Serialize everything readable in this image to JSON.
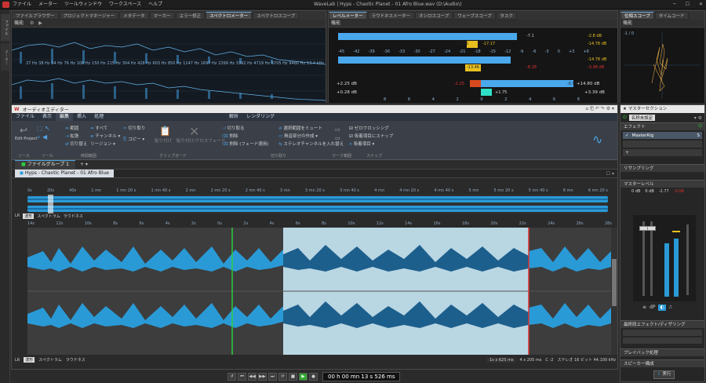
{
  "app": {
    "title": "WaveLab | Hyps - Chaotic Planet - 01 Afro Blue.wav (D:\\Audio\\)"
  },
  "menu": [
    "ファイル",
    "メーター",
    "ツールウィンドウ",
    "ワークスペース",
    "ヘルプ"
  ],
  "left_side_tabs": [
    "ファイル",
    "メーター"
  ],
  "top_left_tabs": [
    "ファイルブラウザー",
    "プロジェクトマネージャー",
    "メタデータ",
    "マーカー",
    "エラー修正",
    "スペクトロメーター",
    "スペクトロスコープ"
  ],
  "top_center_tabs": [
    "レベルメーター",
    "ラウドネスメーター",
    "オシロスコープ",
    "ウェーブスコープ",
    "タスク"
  ],
  "top_right_tabs": [
    "位相スコープ",
    "タイムコード"
  ],
  "panel_mode_label": "機能",
  "spectro": {
    "freqs": [
      "27 Hz",
      "38 Hz",
      "54 Hz",
      "76 Hz",
      "108 Hz",
      "150 Hz",
      "215 Hz",
      "304 Hz",
      "428 Hz",
      "603 Hz",
      "850 Hz",
      "1147 Hz",
      "1697 Hz",
      "2399 Hz",
      "3392 Hz",
      "4719 Hz",
      "6705 Hz",
      "9480 Hz",
      "13.4 kHz"
    ]
  },
  "levelmeter": {
    "scale": [
      "-45",
      "-42",
      "-39",
      "-36",
      "-33",
      "-30",
      "-27",
      "-24",
      "-21",
      "-18",
      "-15",
      "-12",
      "-9",
      "-6",
      "-3",
      "0",
      "+3",
      "+6"
    ],
    "ch1": {
      "rms": "-11.86",
      "peak_label": "-7.1",
      "max": "-17.17",
      "right": "-2.8 dB",
      "right2": "-14.78 dB"
    },
    "ch2": {
      "rms": "-13.46",
      "peak_label": "-8.28",
      "right": "-3.08 dB",
      "right2": "-14.78 dB"
    },
    "bal_left": "+2.25 dB",
    "bal_left2": "+0.28 dB",
    "bal_mid": "-2.25",
    "bal_mid2": "+1.75",
    "bal_r": "-0.57",
    "bal_right": "+14.80 dB",
    "bal_right2": "+3.39 dB",
    "bottom_scale": [
      "8",
      "6",
      "4",
      "2",
      "0",
      "2",
      "4",
      "6",
      "8"
    ]
  },
  "phasescope": {
    "scale": "-1 / 0"
  },
  "audio_editor": {
    "title": "オーディオエディター",
    "ribbon_tabs": [
      "ファイル",
      "表示",
      "編集",
      "挿入",
      "処理",
      "解析",
      "レンダリング"
    ],
    "groups": [
      "ソース",
      "ツール",
      "時間範囲",
      "クリップボード",
      "切り取り",
      "マーク範囲",
      "スナップ"
    ],
    "buttons": {
      "edit_project": "Edit Project",
      "range": "範囲",
      "all": "すべて",
      "extend": "拡張",
      "channel": "チャンネル",
      "toggle": "切り替え",
      "region": "リージョン",
      "cut": "切り取り",
      "copy": "コピー",
      "paste": "貼り付け",
      "paste_crossfade": "貼り付け/クロスフェード",
      "trim": "切り取る",
      "delete": "削除",
      "delete_fade": "削除 (フェード適用)",
      "mute_sel": "選択範囲をミュート",
      "create_silence": "無音部分の作成",
      "stereo_swap": "ステレオチャンネルを入れ替え",
      "zero_cross": "ゼロクロッシング",
      "snap_marks": "吸着項目にスナップ",
      "snap_items": "吸着項目"
    },
    "file_group_tab": "ファイルグループ 1",
    "file_tab": "Hyps - Chaotic Planet - 01 Afro Blue",
    "overview_ruler": [
      "0s",
      "20s",
      "40s",
      "1 mn",
      "1 mn 20 s",
      "1 mn 40 s",
      "2 mn",
      "2 mn 20 s",
      "2 mn 40 s",
      "3 mn",
      "3 mn 20 s",
      "3 mn 40 s",
      "4 mn",
      "4 mn 20 s",
      "4 mn 40 s",
      "5 mn",
      "5 mn 20 s",
      "5 mn 40 s",
      "6 mn",
      "6 mn 20 s"
    ],
    "main_ruler": [
      "14s",
      "12s",
      "10s",
      "8s",
      "6s",
      "4s",
      "2s",
      "0s",
      "2s",
      "4s",
      "6s",
      "8s",
      "10s",
      "12s",
      "14s",
      "16s",
      "18s",
      "20s",
      "22s",
      "24s",
      "26s",
      "28s"
    ],
    "view_tabs": [
      "波形",
      "スペクトラム",
      "ラウドネス"
    ],
    "status": {
      "zoom": "1s x 625 ms",
      "fmt": "4 x 205 ms",
      "ch": "C -2",
      "info": "ステレオ 16 ビット 44.100 kHz"
    }
  },
  "transport": {
    "time": "00 h 00 mn 13 s 526 ms"
  },
  "master": {
    "title": "マスターセクション",
    "preset": "名称未設定",
    "effects": "エフェクト",
    "plugin": "MasterRig",
    "resampling": "リサンプリング",
    "master_level": "マスターレベル",
    "levels": [
      "0 dB",
      "0 dB",
      "-2.77",
      "-3.08"
    ],
    "final_effects": "最終段エフェクト/ディザリング",
    "playback": "プレイバック処理",
    "speaker": "スピーカー構成",
    "render": "実行"
  },
  "colors": {
    "accent": "#4fa3e0",
    "selection": "#b9d6e3",
    "wave": "#2a9ad6",
    "cursor_green": "#2ecc40",
    "cursor_red": "#e03030"
  }
}
